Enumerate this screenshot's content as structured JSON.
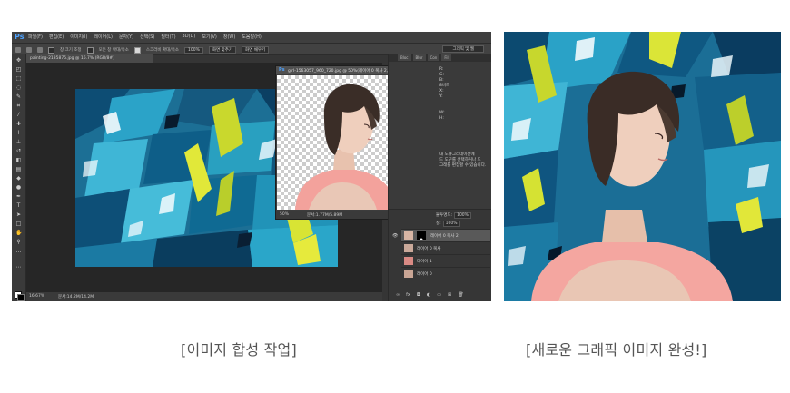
{
  "photoshop": {
    "logo": "Ps",
    "menu": [
      "파일(F)",
      "편집(E)",
      "이미지(I)",
      "레이어(L)",
      "문자(Y)",
      "선택(S)",
      "필터(T)",
      "3D(D)",
      "보기(V)",
      "창(W)",
      "도움말(H)"
    ],
    "options": {
      "auto_align": "모든 레이어 샘플링",
      "sample_all": "자동 향상",
      "resize_windows": "창 크기 조정",
      "zoom_all": "모든 창 확대/축소",
      "scrubby_zoom": "스크러비 확대/축소",
      "zoom_value": "100%",
      "fit_screen": "화면 맞추기",
      "fill_screen": "화면 채우기",
      "workspace": "그래픽 및 웹"
    },
    "document_tab": "painting-2135875.jpg @ 16.7% (RGB/8#)",
    "status_zoom": "16.67%",
    "status_doc": "문서:14.2M/14.2M",
    "float_window": {
      "title": "girl-1563057_960_720.jpg @ 50%(레이어 0 복사 2, 레...",
      "zoom": "50%",
      "doc": "문서:1.77M/5.89M"
    },
    "panel_tabs": [
      "Bloc",
      "Blur",
      "Con",
      "Fil"
    ],
    "info_lines": [
      "R:",
      "G:",
      "B:",
      "8비트",
      "X:",
      "Y:",
      "",
      "",
      "W:",
      "H:"
    ],
    "props_lines": [
      "내 도큐그라데이션에",
      "드 도구를 선택하거나 드",
      "그래를 편집할 수 있습니다."
    ],
    "layer_controls": {
      "opacity_label": "불투명도:",
      "opacity_value": "100%",
      "fill_label": "칠:",
      "fill_value": "100%"
    },
    "layers": [
      {
        "name": "레이어 0 복사 2",
        "visible": true,
        "selected": true
      },
      {
        "name": "레이어 0 복사",
        "visible": false,
        "selected": false
      },
      {
        "name": "레이어 1",
        "visible": false,
        "selected": false
      },
      {
        "name": "레이어 0",
        "visible": false,
        "selected": false
      }
    ]
  },
  "captions": {
    "left": "[이미지 합성 작업]",
    "right": "[새로운 그래픽 이미지 완성!]"
  },
  "colors": {
    "accent": "#4fa3ff",
    "ui_dark": "#353535",
    "canvas_bg": "#262626",
    "caption": "#555555",
    "shirt": "#f4a6a0"
  }
}
